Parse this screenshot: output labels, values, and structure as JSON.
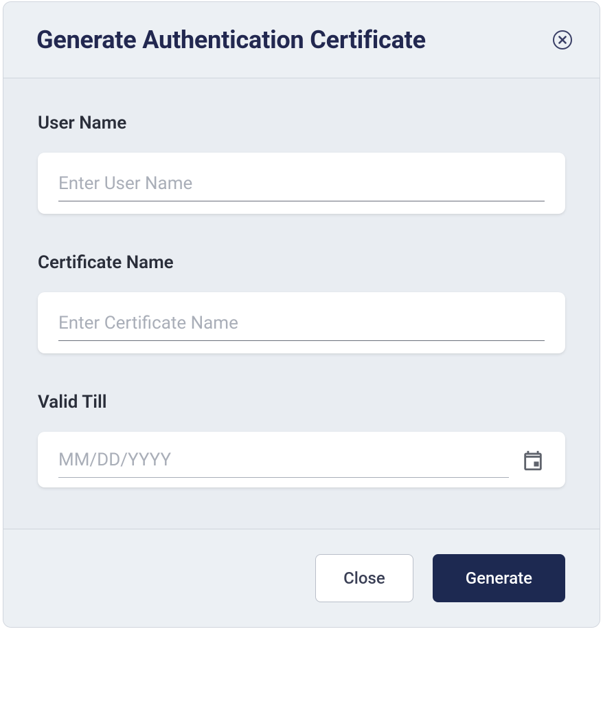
{
  "dialog": {
    "title": "Generate Authentication Certificate",
    "fields": {
      "username": {
        "label": "User Name",
        "placeholder": "Enter User Name",
        "value": ""
      },
      "certname": {
        "label": "Certificate Name",
        "placeholder": "Enter Certificate Name",
        "value": ""
      },
      "validtill": {
        "label": "Valid Till",
        "placeholder": "MM/DD/YYYY",
        "value": ""
      }
    },
    "footer": {
      "close_label": "Close",
      "generate_label": "Generate"
    }
  }
}
